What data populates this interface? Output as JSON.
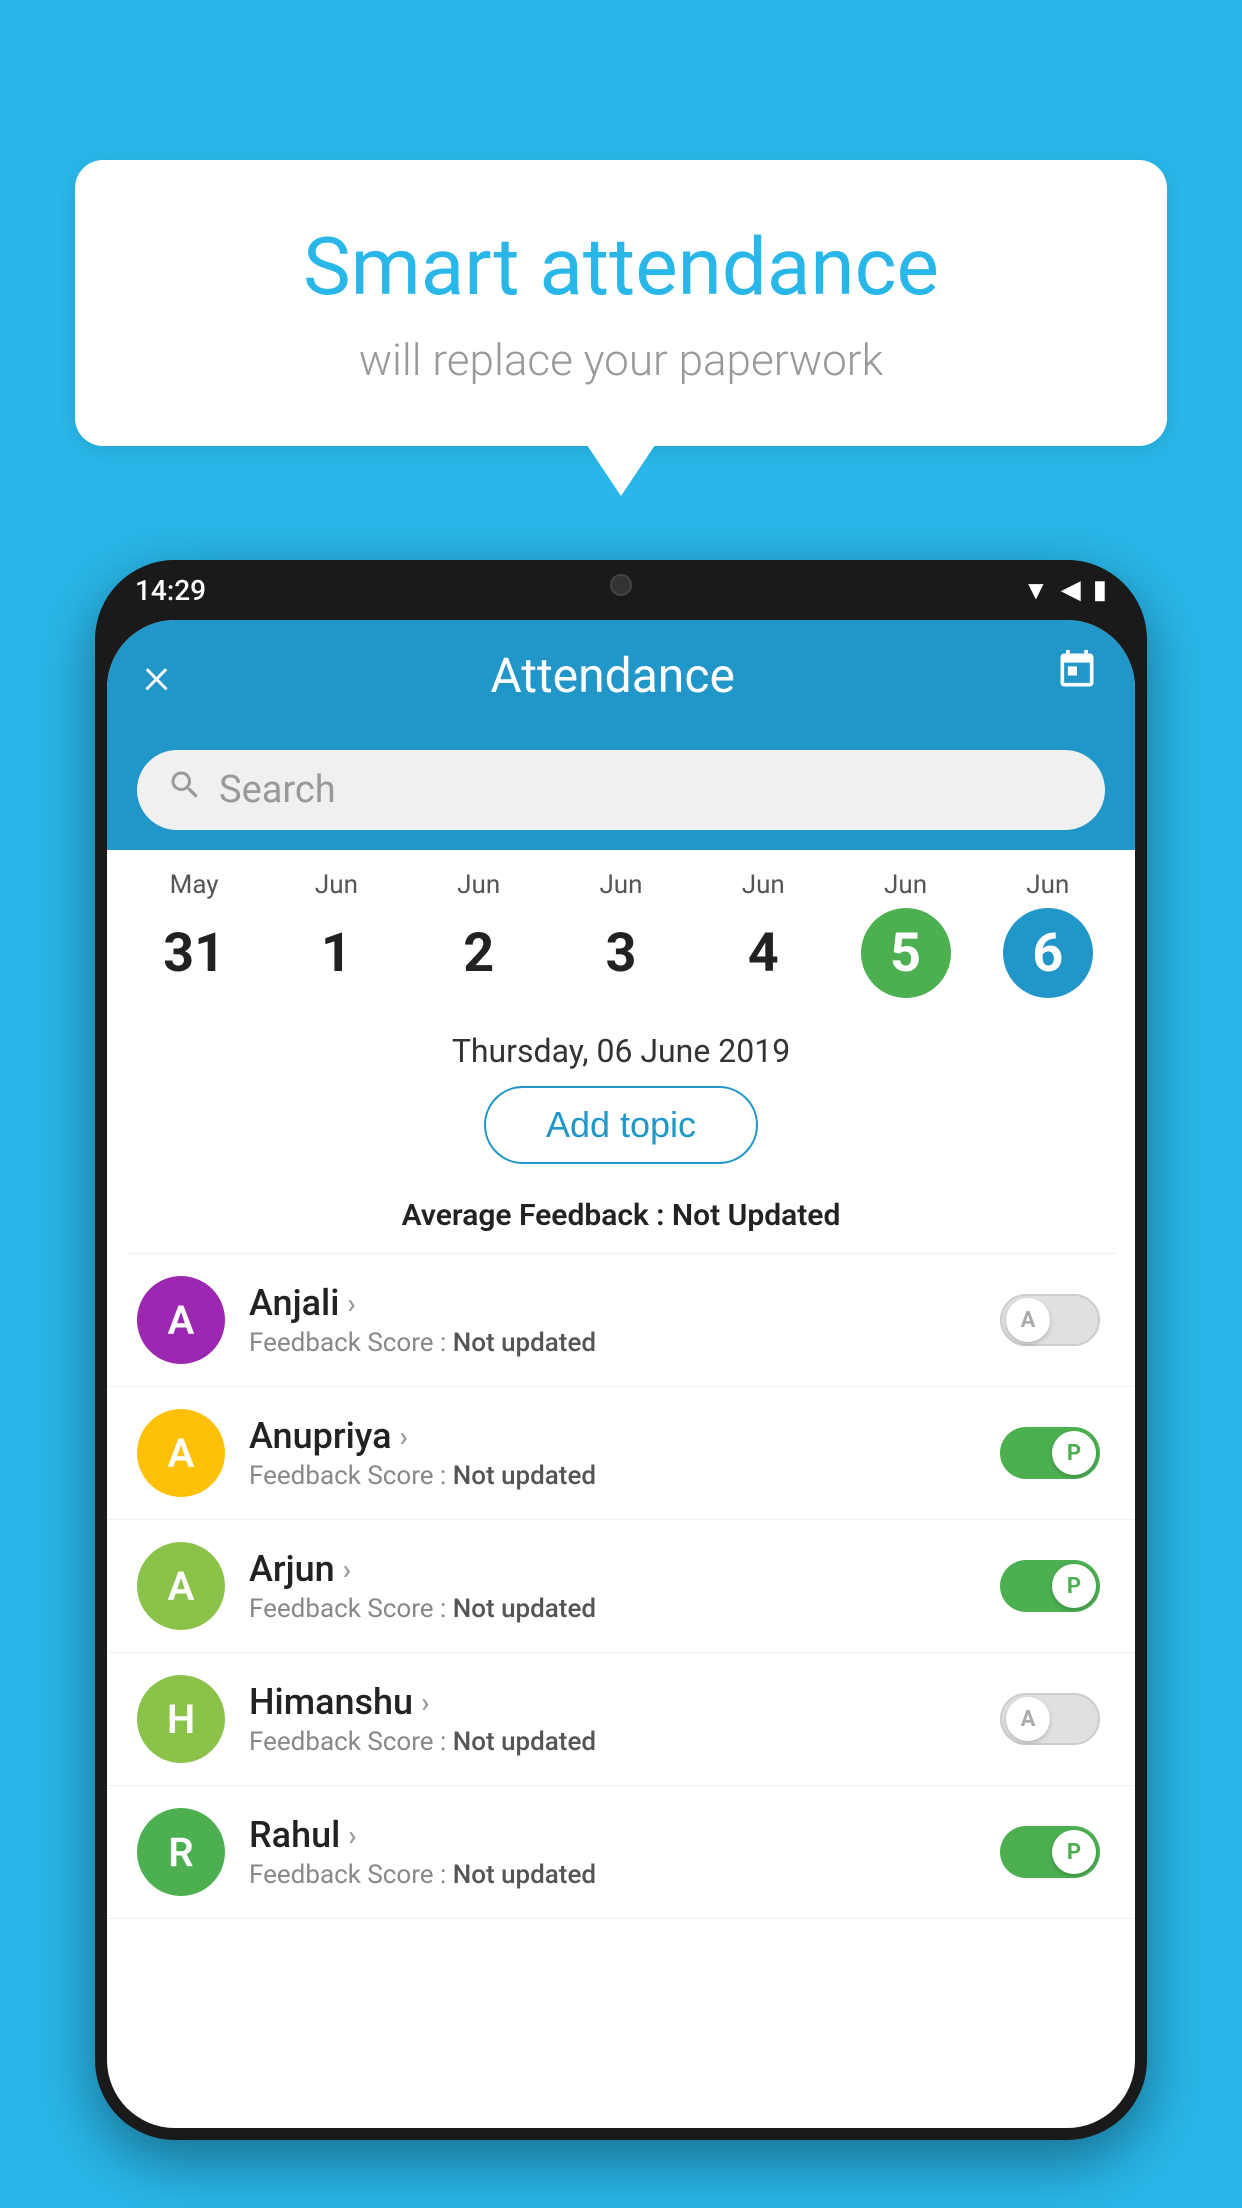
{
  "background_color": "#29B6E8",
  "speech_bubble": {
    "title": "Smart attendance",
    "subtitle": "will replace your paperwork"
  },
  "status_bar": {
    "time": "14:29",
    "wifi": "▼",
    "signal": "▲",
    "battery": "▮"
  },
  "app_bar": {
    "title": "Attendance",
    "close_label": "×",
    "calendar_label": "📅"
  },
  "search": {
    "placeholder": "Search"
  },
  "calendar": {
    "days": [
      {
        "month": "May",
        "date": "31",
        "style": "normal"
      },
      {
        "month": "Jun",
        "date": "1",
        "style": "normal"
      },
      {
        "month": "Jun",
        "date": "2",
        "style": "normal"
      },
      {
        "month": "Jun",
        "date": "3",
        "style": "normal"
      },
      {
        "month": "Jun",
        "date": "4",
        "style": "normal"
      },
      {
        "month": "Jun",
        "date": "5",
        "style": "today"
      },
      {
        "month": "Jun",
        "date": "6",
        "style": "selected"
      }
    ],
    "selected_date": "Thursday, 06 June 2019"
  },
  "add_topic_label": "Add topic",
  "avg_feedback_label": "Average Feedback : ",
  "avg_feedback_value": "Not Updated",
  "students": [
    {
      "name": "Anjali",
      "avatar_letter": "A",
      "avatar_color": "#9C27B0",
      "feedback": "Feedback Score : ",
      "feedback_value": "Not updated",
      "toggle": "off",
      "toggle_label": "A"
    },
    {
      "name": "Anupriya",
      "avatar_letter": "A",
      "avatar_color": "#FFC107",
      "feedback": "Feedback Score : ",
      "feedback_value": "Not updated",
      "toggle": "on",
      "toggle_label": "P"
    },
    {
      "name": "Arjun",
      "avatar_letter": "A",
      "avatar_color": "#8BC34A",
      "feedback": "Feedback Score : ",
      "feedback_value": "Not updated",
      "toggle": "on",
      "toggle_label": "P"
    },
    {
      "name": "Himanshu",
      "avatar_letter": "H",
      "avatar_color": "#8BC34A",
      "feedback": "Feedback Score : ",
      "feedback_value": "Not updated",
      "toggle": "off",
      "toggle_label": "A"
    },
    {
      "name": "Rahul",
      "avatar_letter": "R",
      "avatar_color": "#4CAF50",
      "feedback": "Feedback Score : ",
      "feedback_value": "Not updated",
      "toggle": "on",
      "toggle_label": "P"
    }
  ]
}
